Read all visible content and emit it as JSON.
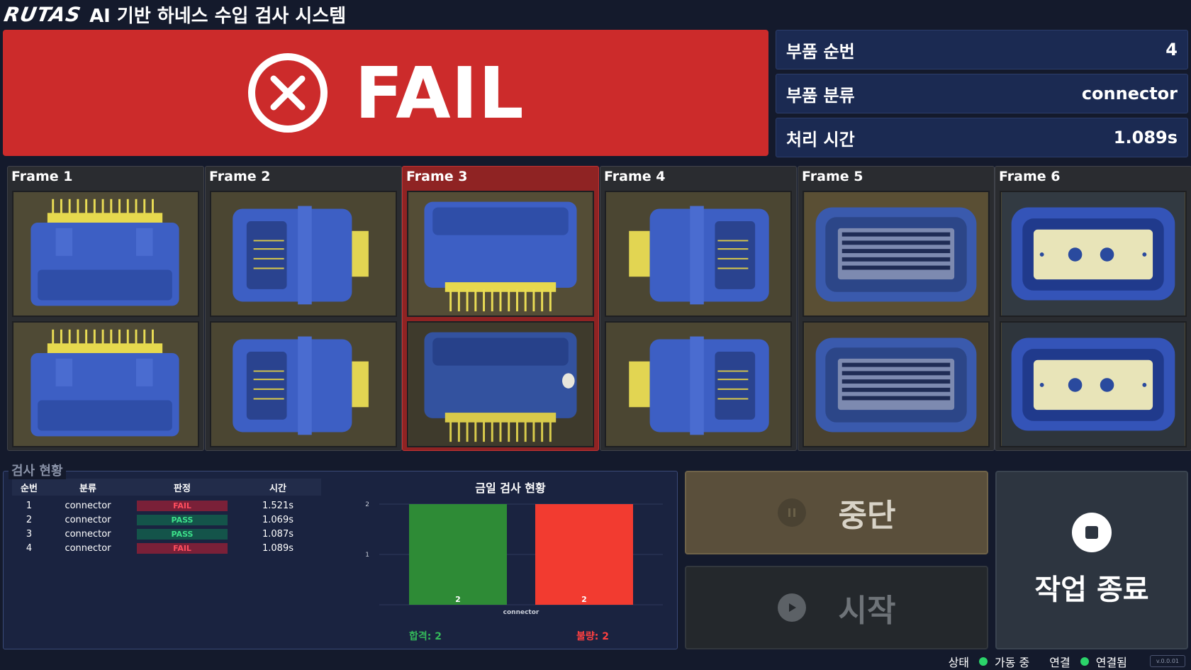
{
  "header": {
    "logo": "RUTAS",
    "title": "AI 기반 하네스 수입 검사 시스템"
  },
  "result": {
    "label": "FAIL",
    "color": "#cc2b2b"
  },
  "info": [
    {
      "label": "부품 순번",
      "value": "4"
    },
    {
      "label": "부품 분류",
      "value": "connector"
    },
    {
      "label": "처리 시간",
      "value": "1.089s"
    }
  ],
  "frames": [
    {
      "label": "Frame 1",
      "status": "normal"
    },
    {
      "label": "Frame 2",
      "status": "normal"
    },
    {
      "label": "Frame 3",
      "status": "fail"
    },
    {
      "label": "Frame 4",
      "status": "normal"
    },
    {
      "label": "Frame 5",
      "status": "normal"
    },
    {
      "label": "Frame 6",
      "status": "normal"
    }
  ],
  "stats": {
    "legend": "검사 현황",
    "columns": [
      "순번",
      "분류",
      "판정",
      "시간"
    ],
    "rows": [
      {
        "no": "1",
        "type": "connector",
        "verdict": "FAIL",
        "time": "1.521s"
      },
      {
        "no": "2",
        "type": "connector",
        "verdict": "PASS",
        "time": "1.069s"
      },
      {
        "no": "3",
        "type": "connector",
        "verdict": "PASS",
        "time": "1.087s"
      },
      {
        "no": "4",
        "type": "connector",
        "verdict": "FAIL",
        "time": "1.089s"
      }
    ]
  },
  "chart_data": {
    "type": "bar",
    "title": "금일 검사 현황",
    "categories": [
      "connector"
    ],
    "series": [
      {
        "values": [
          2
        ],
        "color": "#2e8b36"
      },
      {
        "values": [
          2
        ],
        "color": "#f23b30"
      }
    ],
    "ylim": [
      0,
      2
    ],
    "yticks": [
      "2",
      "1"
    ],
    "pass_summary": "합격: 2",
    "fail_summary": "불량: 2"
  },
  "controls": {
    "stop_label": "중단",
    "start_label": "시작",
    "end_label": "작업 종료"
  },
  "statusbar": {
    "state_label": "상태",
    "state_value": "가동 중",
    "conn_label": "연결",
    "conn_value": "연결됨",
    "version": "v.0.0.01"
  }
}
